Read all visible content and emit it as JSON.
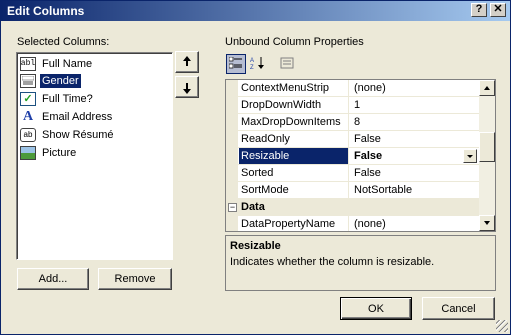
{
  "window": {
    "title": "Edit Columns",
    "help_label": "?",
    "close_label": "✕"
  },
  "selected_columns": {
    "label": "Selected Columns:",
    "items": [
      {
        "label": "Full Name",
        "icon": "textbox-icon",
        "icon_text": "abl"
      },
      {
        "label": "Gender",
        "icon": "combobox-icon",
        "icon_text": "",
        "selected": true
      },
      {
        "label": "Full Time?",
        "icon": "checkbox-icon",
        "icon_text": "✓"
      },
      {
        "label": "Email Address",
        "icon": "link-icon",
        "icon_text": "A"
      },
      {
        "label": "Show Résumé",
        "icon": "button-icon",
        "icon_text": "ab"
      },
      {
        "label": "Picture",
        "icon": "image-icon",
        "icon_text": ""
      }
    ],
    "add_label": "Add...",
    "remove_label": "Remove"
  },
  "properties": {
    "label": "Unbound Column Properties",
    "rows": [
      {
        "name": "ContextMenuStrip",
        "value": "(none)"
      },
      {
        "name": "DropDownWidth",
        "value": "1"
      },
      {
        "name": "MaxDropDownItems",
        "value": "8"
      },
      {
        "name": "ReadOnly",
        "value": "False"
      },
      {
        "name": "Resizable",
        "value": "False",
        "selected": true
      },
      {
        "name": "Sorted",
        "value": "False"
      },
      {
        "name": "SortMode",
        "value": "NotSortable"
      },
      {
        "category": "Data"
      },
      {
        "name": "DataPropertyName",
        "value": "(none)"
      }
    ],
    "description_title": "Resizable",
    "description_text": "Indicates whether the column is resizable.",
    "toolbar": {
      "categorized_icon": "categorized-icon",
      "alphabetical_icon": "sort-az-icon",
      "pages_icon": "property-pages-icon"
    }
  },
  "footer": {
    "ok_label": "OK",
    "cancel_label": "Cancel"
  },
  "colors": {
    "title_bar": "#0a246a",
    "selection": "#0a246a",
    "dialog_bg": "#ece9d8"
  }
}
